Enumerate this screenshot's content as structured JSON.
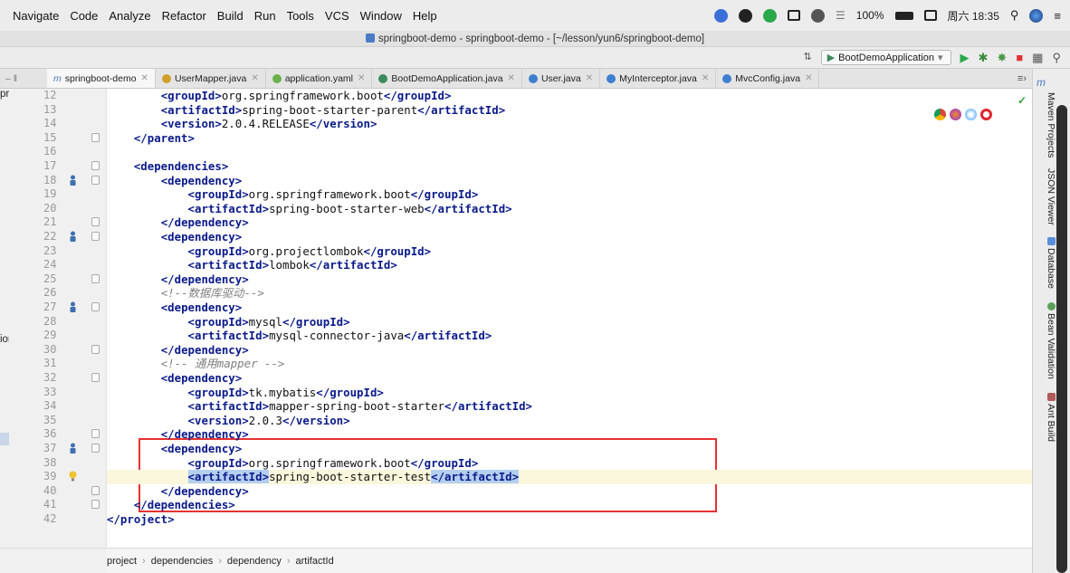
{
  "menubar": {
    "items": [
      "Navigate",
      "Code",
      "Analyze",
      "Refactor",
      "Build",
      "Run",
      "Tools",
      "VCS",
      "Window",
      "Help"
    ],
    "battery": "100%",
    "clock": "周六 18:35"
  },
  "window": {
    "title": "springboot-demo - springboot-demo - [~/lesson/yun6/springboot-demo]"
  },
  "toolbar": {
    "run_config": "BootDemoApplication"
  },
  "tabs": [
    {
      "label": "springboot-demo",
      "icon_color": "#4a7bc4",
      "icon": "maven-icon"
    },
    {
      "label": "UserMapper.java",
      "icon_color": "#d0a02a",
      "icon": "interface-icon"
    },
    {
      "label": "application.yaml",
      "icon_color": "#6ab04c",
      "icon": "yaml-icon"
    },
    {
      "label": "BootDemoApplication.java",
      "icon_color": "#3c8b5c",
      "icon": "springboot-icon"
    },
    {
      "label": "User.java",
      "icon_color": "#3f7fd0",
      "icon": "class-icon"
    },
    {
      "label": "MyInterceptor.java",
      "icon_color": "#3f7fd0",
      "icon": "class-icon"
    },
    {
      "label": "MvcConfig.java",
      "icon_color": "#3f7fd0",
      "icon": "class-icon"
    }
  ],
  "project_panel": {
    "items": [
      "pring",
      "ion"
    ]
  },
  "editor": {
    "lines": [
      {
        "num": "12",
        "indent": "        ",
        "parts": [
          {
            "t": "tag",
            "v": "<groupId>"
          },
          {
            "t": "txt",
            "v": "org.springframework.boot"
          },
          {
            "t": "tag",
            "v": "</groupId>"
          }
        ]
      },
      {
        "num": "13",
        "indent": "        ",
        "parts": [
          {
            "t": "tag",
            "v": "<artifactId>"
          },
          {
            "t": "txt",
            "v": "spring-boot-starter-parent"
          },
          {
            "t": "tag",
            "v": "</artifactId>"
          }
        ]
      },
      {
        "num": "14",
        "indent": "        ",
        "parts": [
          {
            "t": "tag",
            "v": "<version>"
          },
          {
            "t": "txt",
            "v": "2.0.4.RELEASE"
          },
          {
            "t": "tag",
            "v": "</version>"
          }
        ]
      },
      {
        "num": "15",
        "indent": "    ",
        "parts": [
          {
            "t": "tag",
            "v": "</parent>"
          }
        ]
      },
      {
        "num": "16",
        "indent": "",
        "parts": []
      },
      {
        "num": "17",
        "indent": "    ",
        "parts": [
          {
            "t": "tag",
            "v": "<dependencies>"
          }
        ]
      },
      {
        "num": "18",
        "indent": "        ",
        "parts": [
          {
            "t": "tag",
            "v": "<dependency>"
          }
        ]
      },
      {
        "num": "19",
        "indent": "            ",
        "parts": [
          {
            "t": "tag",
            "v": "<groupId>"
          },
          {
            "t": "txt",
            "v": "org.springframework.boot"
          },
          {
            "t": "tag",
            "v": "</groupId>"
          }
        ]
      },
      {
        "num": "20",
        "indent": "            ",
        "parts": [
          {
            "t": "tag",
            "v": "<artifactId>"
          },
          {
            "t": "txt",
            "v": "spring-boot-starter-web"
          },
          {
            "t": "tag",
            "v": "</artifactId>"
          }
        ]
      },
      {
        "num": "21",
        "indent": "        ",
        "parts": [
          {
            "t": "tag",
            "v": "</dependency>"
          }
        ]
      },
      {
        "num": "22",
        "indent": "        ",
        "parts": [
          {
            "t": "tag",
            "v": "<dependency>"
          }
        ]
      },
      {
        "num": "23",
        "indent": "            ",
        "parts": [
          {
            "t": "tag",
            "v": "<groupId>"
          },
          {
            "t": "txt",
            "v": "org.projectlombok"
          },
          {
            "t": "tag",
            "v": "</groupId>"
          }
        ]
      },
      {
        "num": "24",
        "indent": "            ",
        "parts": [
          {
            "t": "tag",
            "v": "<artifactId>"
          },
          {
            "t": "txt",
            "v": "lombok"
          },
          {
            "t": "tag",
            "v": "</artifactId>"
          }
        ]
      },
      {
        "num": "25",
        "indent": "        ",
        "parts": [
          {
            "t": "tag",
            "v": "</dependency>"
          }
        ]
      },
      {
        "num": "26",
        "indent": "        ",
        "parts": [
          {
            "t": "comment",
            "v": "<!--数据库驱动-->"
          }
        ]
      },
      {
        "num": "27",
        "indent": "        ",
        "parts": [
          {
            "t": "tag",
            "v": "<dependency>"
          }
        ]
      },
      {
        "num": "28",
        "indent": "            ",
        "parts": [
          {
            "t": "tag",
            "v": "<groupId>"
          },
          {
            "t": "txt",
            "v": "mysql"
          },
          {
            "t": "tag",
            "v": "</groupId>"
          }
        ]
      },
      {
        "num": "29",
        "indent": "            ",
        "parts": [
          {
            "t": "tag",
            "v": "<artifactId>"
          },
          {
            "t": "txt",
            "v": "mysql-connector-java"
          },
          {
            "t": "tag",
            "v": "</artifactId>"
          }
        ]
      },
      {
        "num": "30",
        "indent": "        ",
        "parts": [
          {
            "t": "tag",
            "v": "</dependency>"
          }
        ]
      },
      {
        "num": "31",
        "indent": "        ",
        "parts": [
          {
            "t": "comment",
            "v": "<!-- 通用mapper -->"
          }
        ]
      },
      {
        "num": "32",
        "indent": "        ",
        "parts": [
          {
            "t": "tag",
            "v": "<dependency>"
          }
        ]
      },
      {
        "num": "33",
        "indent": "            ",
        "parts": [
          {
            "t": "tag",
            "v": "<groupId>"
          },
          {
            "t": "txt",
            "v": "tk.mybatis"
          },
          {
            "t": "tag",
            "v": "</groupId>"
          }
        ]
      },
      {
        "num": "34",
        "indent": "            ",
        "parts": [
          {
            "t": "tag",
            "v": "<artifactId>"
          },
          {
            "t": "txt",
            "v": "mapper-spring-boot-starter"
          },
          {
            "t": "tag",
            "v": "</artifactId>"
          }
        ]
      },
      {
        "num": "35",
        "indent": "            ",
        "parts": [
          {
            "t": "tag",
            "v": "<version>"
          },
          {
            "t": "txt",
            "v": "2.0.3"
          },
          {
            "t": "tag",
            "v": "</version>"
          }
        ]
      },
      {
        "num": "36",
        "indent": "        ",
        "parts": [
          {
            "t": "tag",
            "v": "</dependency>"
          }
        ]
      },
      {
        "num": "37",
        "indent": "        ",
        "parts": [
          {
            "t": "tag",
            "v": "<dependency>"
          }
        ]
      },
      {
        "num": "38",
        "indent": "            ",
        "parts": [
          {
            "t": "tag",
            "v": "<groupId>"
          },
          {
            "t": "txt",
            "v": "org.springframework.boot"
          },
          {
            "t": "tag",
            "v": "</groupId>"
          }
        ]
      },
      {
        "num": "39",
        "indent": "            ",
        "current": true,
        "parts": [
          {
            "t": "tag hl",
            "v": "<artifactId>"
          },
          {
            "t": "txt",
            "v": "spring-boot-starter-test"
          },
          {
            "t": "tag hl",
            "v": "</artifactId>"
          }
        ]
      },
      {
        "num": "40",
        "indent": "        ",
        "parts": [
          {
            "t": "tag",
            "v": "</dependency>"
          }
        ]
      },
      {
        "num": "41",
        "indent": "    ",
        "parts": [
          {
            "t": "tag",
            "v": "</dependencies>"
          }
        ]
      },
      {
        "num": "42",
        "indent": "",
        "parts": [
          {
            "t": "tag",
            "v": "</project>"
          }
        ]
      }
    ],
    "run_markers": [
      "18",
      "22",
      "27",
      "37"
    ],
    "bulb_line": "39"
  },
  "breadcrumb": [
    "project",
    "dependencies",
    "dependency",
    "artifactId"
  ],
  "right_tools": [
    "Maven Projects",
    "JSON Viewer",
    "Database",
    "Bean Validation",
    "Ant Build"
  ],
  "colors": {
    "tag": "#0a1a8a",
    "highlight": "#b4cff0",
    "annotation_box": "#e53232",
    "current_line": "#fbf7dc"
  }
}
